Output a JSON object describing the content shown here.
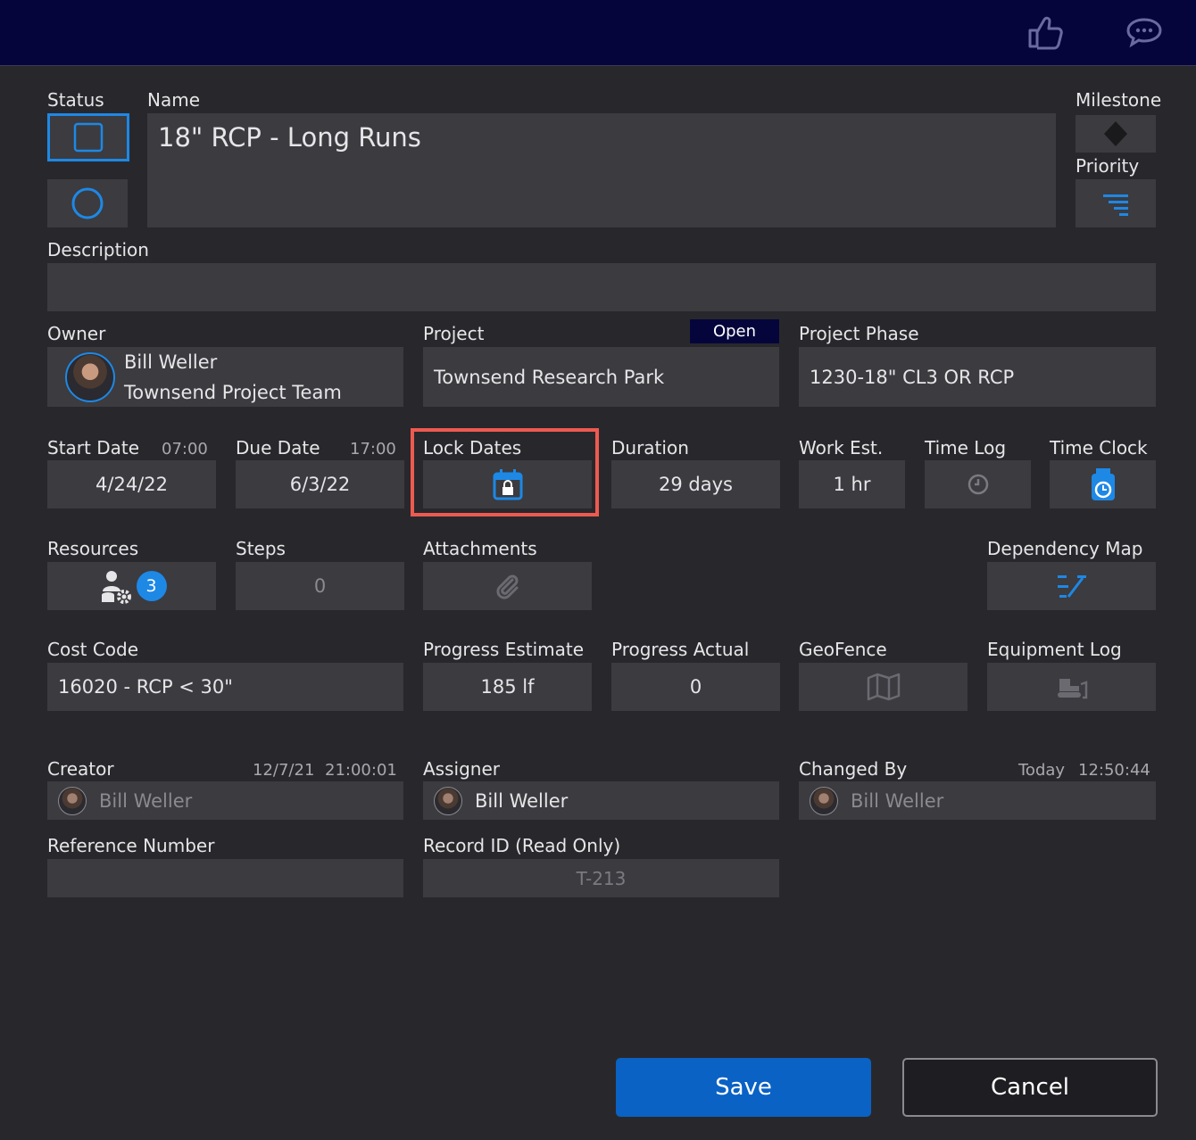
{
  "colors": {
    "accent": "#1e88e5",
    "header": "#05053c",
    "field": "#3b3b40",
    "highlight": "#ee5a50",
    "save": "#0a62c4"
  },
  "header": {
    "icons": [
      "thumbs-up-icon",
      "chat-icon"
    ]
  },
  "labels": {
    "status": "Status",
    "name": "Name",
    "milestone": "Milestone",
    "priority": "Priority",
    "description": "Description",
    "owner": "Owner",
    "project": "Project",
    "project_phase": "Project Phase",
    "start_date": "Start Date",
    "due_date": "Due Date",
    "lock_dates": "Lock Dates",
    "duration": "Duration",
    "work_est": "Work Est.",
    "time_log": "Time Log",
    "time_clock": "Time Clock",
    "resources": "Resources",
    "steps": "Steps",
    "attachments": "Attachments",
    "dependency_map": "Dependency Map",
    "cost_code": "Cost Code",
    "progress_estimate": "Progress Estimate",
    "progress_actual": "Progress Actual",
    "geofence": "GeoFence",
    "equipment_log": "Equipment Log",
    "creator": "Creator",
    "assigner": "Assigner",
    "changed_by": "Changed By",
    "reference_number": "Reference Number",
    "record_id": "Record ID (Read Only)"
  },
  "values": {
    "name": "18\" RCP - Long Runs",
    "description": "",
    "owner_name": "Bill Weller",
    "owner_team": "Townsend Project Team",
    "project": "Townsend Research Park",
    "project_badge": "Open",
    "project_phase": "1230-18\" CL3 OR RCP",
    "start_time": "07:00",
    "start_date": "4/24/22",
    "due_time": "17:00",
    "due_date": "6/3/22",
    "duration": "29 days",
    "work_est": "1 hr",
    "resources_count": "3",
    "steps": "0",
    "cost_code": "16020 - RCP < 30\"",
    "progress_estimate": "185 lf",
    "progress_actual": "0",
    "creator_date": "12/7/21",
    "creator_time": "21:00:01",
    "creator_name": "Bill Weller",
    "assigner_name": "Bill Weller",
    "changed_date": "Today",
    "changed_time": "12:50:44",
    "changed_name": "Bill Weller",
    "reference_number": "",
    "record_id": "T-213"
  },
  "buttons": {
    "save": "Save",
    "cancel": "Cancel"
  }
}
